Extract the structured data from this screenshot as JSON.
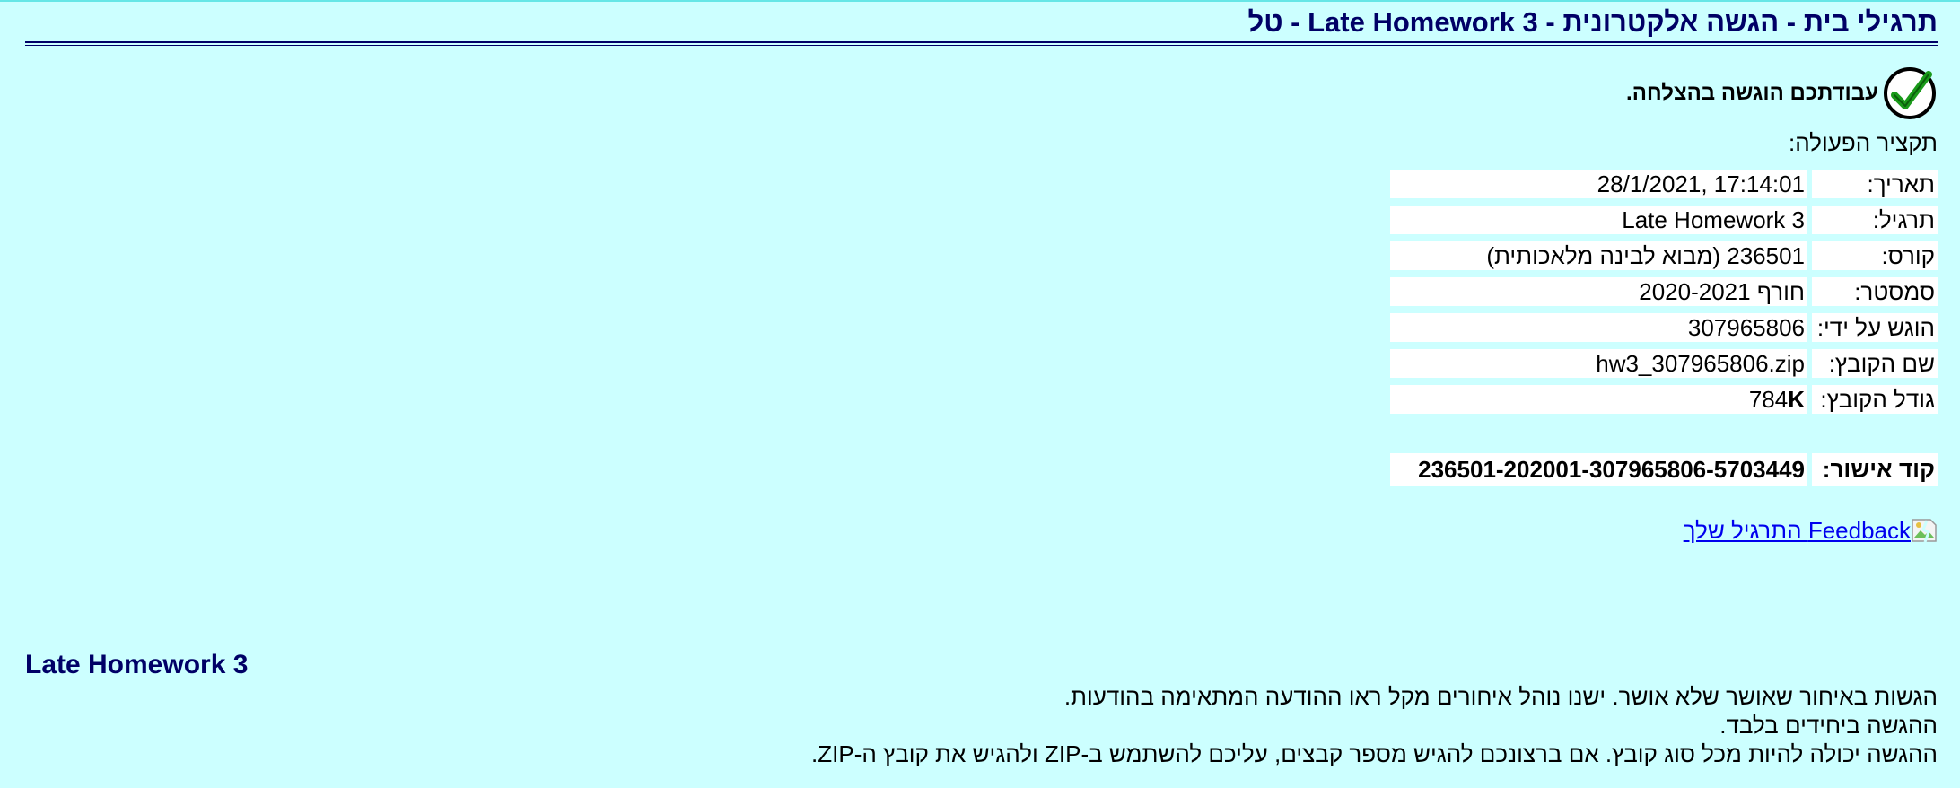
{
  "header": {
    "title": "תרגילי בית - הגשה אלקטרונית - Late Homework 3 - טל"
  },
  "status": {
    "success_message": "עבודתכם הוגשה בהצלחה.",
    "icon": "checkmark-icon"
  },
  "summary": {
    "heading": "תקציר הפעולה:",
    "rows": [
      {
        "label": "תאריך:",
        "value": "28/1/2021, 17:14:01"
      },
      {
        "label": "תרגיל:",
        "value": "Late Homework 3"
      },
      {
        "label": "קורס:",
        "value": "236501 (מבוא לבינה מלאכותית)"
      },
      {
        "label": "סמסטר:",
        "value": "חורף 2020-2021"
      },
      {
        "label": "הוגש על ידי:",
        "value": "307965806"
      },
      {
        "label": "שם הקובץ:",
        "value": "hw3_307965806.zip"
      },
      {
        "label": "גודל הקובץ:",
        "value": "784",
        "unit": "K"
      }
    ]
  },
  "approval": {
    "label": "קוד אישור:",
    "code": "236501-202001-307965806-5703449"
  },
  "feedback": {
    "link_text": "Feedback התרגיל שלך",
    "icon": "broken-image-icon"
  },
  "assignment": {
    "title": "Late Homework 3",
    "notes": [
      "הגשות באיחור שאושר שלא אושר. ישנו נוהל איחורים מקל ראו ההודעה המתאימה בהודעות.",
      "ההגשה ביחידים בלבד.",
      "ההגשה יכולה להיות מכל סוג קובץ. אם ברצונכם להגיש מספר קבצים, עליכם להשתמש ב-ZIP ולהגיש את קובץ ה-ZIP."
    ]
  },
  "colors": {
    "background": "#ccffff",
    "title": "#000066",
    "link": "#0000ee",
    "cell": "#ffffff"
  }
}
